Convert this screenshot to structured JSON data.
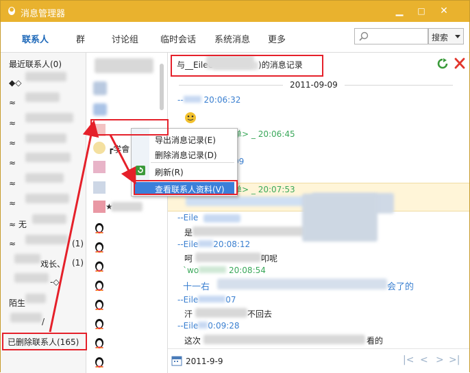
{
  "window": {
    "title": "消息管理器",
    "minimize": "▁",
    "maximize": "□",
    "close": "✕"
  },
  "tabs": [
    "联系人",
    "群",
    "讨论组",
    "临时会话",
    "系统消息",
    "更多"
  ],
  "search": {
    "placeholder": "",
    "button": "搜索"
  },
  "groups": [
    {
      "label": "最近联系人(0)"
    },
    {
      "label": "◆◇"
    },
    {
      "label": "≈"
    },
    {
      "label": "≈"
    },
    {
      "label": "≈"
    },
    {
      "label": "≈"
    },
    {
      "label": "≈"
    },
    {
      "label": "≈"
    },
    {
      "label": "≈   无"
    },
    {
      "label": "≈",
      "count": "(1)"
    },
    {
      "label": "戏长、",
      "count": "(1)"
    },
    {
      "label": "-◇"
    },
    {
      "label": "陌生"
    },
    {
      "label": "/"
    },
    {
      "label": "已删除联系人(165)"
    }
  ],
  "contacts": [
    {
      "name": "_"
    },
    {
      "name": "┏学會"
    },
    {
      "name": "★"
    }
  ],
  "context_menu": {
    "export": "导出消息记录(E)",
    "delete": "删除消息记录(D)",
    "refresh": "刷新(R)",
    "view_profile": "查看联系人资料(V)"
  },
  "history": {
    "title": "与__Eilee",
    "title_suffix": ")的消息记录",
    "date": "2011-09-09",
    "messages": [
      {
        "sender": "--",
        "time": "20:06:32",
        "body": ""
      },
      {
        "sender": "单> _",
        "time": "20:06:45",
        "body": ""
      },
      {
        "sender": "",
        "time": "09",
        "body": ""
      },
      {
        "sender": "单> _",
        "time": "20:07:53",
        "body": ""
      },
      {
        "sender": "--Eile",
        "time": "",
        "body": "是"
      },
      {
        "sender": "--Eile",
        "time": "20:08:12",
        "body": "呵"
      },
      {
        "sender": "`wo",
        "time": "20:08:54",
        "body": "十一右"
      },
      {
        "sender": "--Eile",
        "time": "07",
        "body": "汗"
      },
      {
        "sender": "--Eile",
        "time": "0:09:28",
        "body": "这次"
      }
    ],
    "body_tail": [
      "叩呢",
      "会了的",
      "不回去",
      "看的"
    ],
    "footer_date": "2011-9-9",
    "nav": [
      "|<",
      "<",
      ">",
      ">|"
    ]
  },
  "colors": {
    "titlebar": "#e9b22e",
    "accent": "#1a66b8",
    "highlight": "#e5202a"
  }
}
